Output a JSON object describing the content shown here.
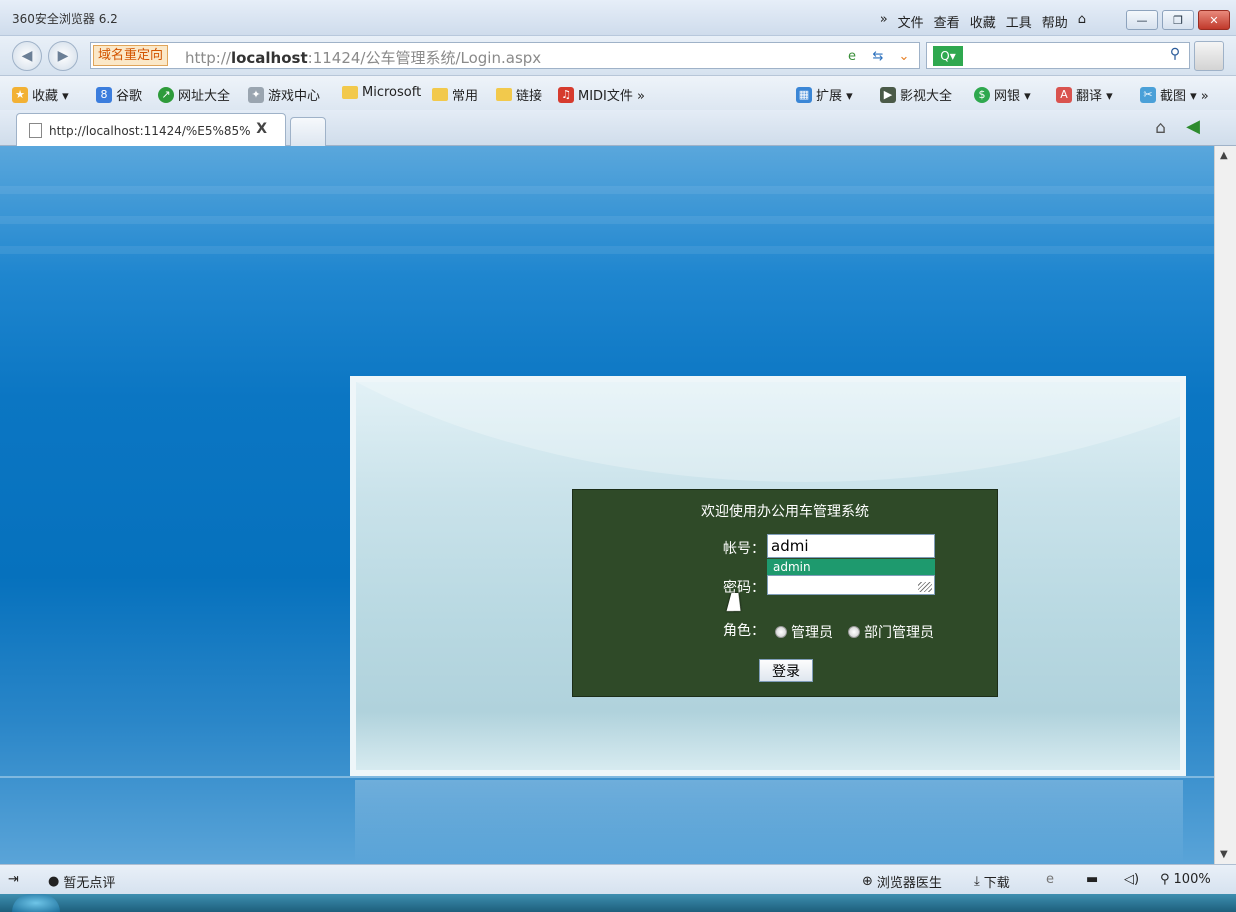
{
  "browser": {
    "title": "360安全浏览器 6.2",
    "menus": [
      "»",
      "文件",
      "查看",
      "收藏",
      "工具",
      "帮助"
    ],
    "redirect_label": "域名重定向",
    "url_prefix": "http://",
    "url_host": "localhost",
    "url_rest": ":11424/公车管理系统/Login.aspx",
    "search_engine": "Q▾"
  },
  "favorites": [
    {
      "label": "收藏 ▾"
    },
    {
      "label": "谷歌"
    },
    {
      "label": "网址大全"
    },
    {
      "label": "游戏中心"
    },
    {
      "label": "Microsoft"
    },
    {
      "label": "常用"
    },
    {
      "label": "链接"
    },
    {
      "label": "MIDI文件 »"
    }
  ],
  "favorites_right": [
    {
      "label": "扩展 ▾"
    },
    {
      "label": "影视大全"
    },
    {
      "label": "网银 ▾"
    },
    {
      "label": "翻译 ▾"
    },
    {
      "label": "截图 ▾ »"
    }
  ],
  "tab": {
    "title": "http://localhost:11424/%E5%85%",
    "close": "X"
  },
  "login": {
    "heading": "欢迎使用办公用车管理系统",
    "account_label": "帐号：",
    "account_value": "admi",
    "suggestion": "admin",
    "password_label": "密码：",
    "role_label": "角色：",
    "role_admin": "管理员",
    "role_dept_admin": "部门管理员",
    "submit": "登录"
  },
  "status": {
    "rating": "暂无点评",
    "doctor": "浏览器医生",
    "download": "下载",
    "zoom": "100%"
  }
}
